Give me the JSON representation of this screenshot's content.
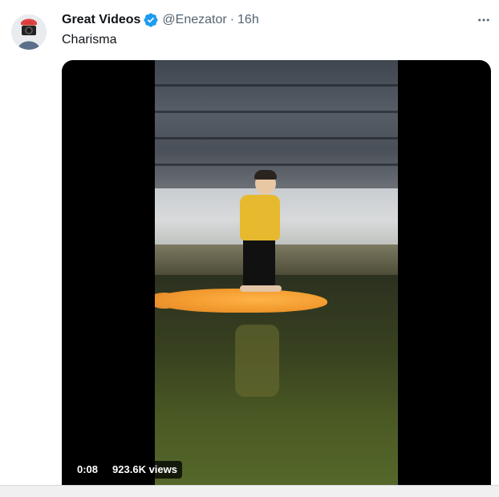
{
  "tweet": {
    "author_name": "Great Videos",
    "verified": true,
    "handle": "@Enezator",
    "separator": "·",
    "time": "16h",
    "text": "Charisma",
    "more_icon": "more-icon",
    "verified_color": "#1d9bf0"
  },
  "video": {
    "elapsed": "0:08",
    "views": "923.6K views"
  }
}
